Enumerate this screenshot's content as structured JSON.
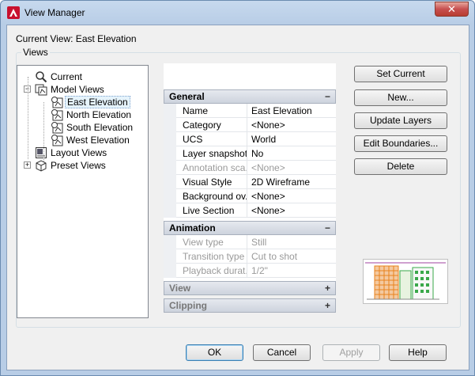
{
  "window": {
    "title": "View Manager",
    "close_label": "✕"
  },
  "current_view": "Current View: East Elevation",
  "views_group_label": "Views",
  "tree": [
    {
      "label": "Current",
      "icon": "magnifier-icon",
      "level": 1,
      "expander": "",
      "selected": false
    },
    {
      "label": "Model Views",
      "icon": "model-views-icon",
      "level": 1,
      "expander": "−",
      "selected": false
    },
    {
      "label": "East Elevation",
      "icon": "named-view-icon",
      "level": 2,
      "expander": "",
      "selected": true
    },
    {
      "label": "North Elevation",
      "icon": "named-view-icon",
      "level": 2,
      "expander": "",
      "selected": false
    },
    {
      "label": "South Elevation",
      "icon": "named-view-icon",
      "level": 2,
      "expander": "",
      "selected": false
    },
    {
      "label": "West Elevation",
      "icon": "named-view-icon",
      "level": 2,
      "expander": "",
      "selected": false
    },
    {
      "label": "Layout Views",
      "icon": "layout-views-icon",
      "level": 1,
      "expander": "",
      "selected": false
    },
    {
      "label": "Preset Views",
      "icon": "preset-views-icon",
      "level": 1,
      "expander": "+",
      "selected": false
    }
  ],
  "properties": {
    "general": {
      "title": "General",
      "toggle": "−",
      "rows": [
        {
          "name": "Name",
          "value": "East Elevation",
          "dim": false
        },
        {
          "name": "Category",
          "value": "<None>",
          "dim": false
        },
        {
          "name": "UCS",
          "value": "World",
          "dim": false
        },
        {
          "name": "Layer snapshot",
          "value": "No",
          "dim": false
        },
        {
          "name": "Annotation sca...",
          "value": "<None>",
          "dim": true
        },
        {
          "name": "Visual Style",
          "value": "2D Wireframe",
          "dim": false
        },
        {
          "name": "Background ov...",
          "value": "<None>",
          "dim": false
        },
        {
          "name": "Live Section",
          "value": "<None>",
          "dim": false
        }
      ]
    },
    "animation": {
      "title": "Animation",
      "toggle": "−",
      "rows": [
        {
          "name": "View type",
          "value": "Still",
          "dim": true
        },
        {
          "name": "Transition type",
          "value": "Cut to shot",
          "dim": true
        },
        {
          "name": "Playback durat...",
          "value": "1/2\"",
          "dim": true
        }
      ]
    },
    "view": {
      "title": "View",
      "toggle": "+"
    },
    "clipping": {
      "title": "Clipping",
      "toggle": "+"
    }
  },
  "side_buttons": [
    {
      "name": "set-current-button",
      "label": "Set Current"
    },
    {
      "name": "new-button",
      "label": "New..."
    },
    {
      "name": "update-layers-button",
      "label": "Update Layers"
    },
    {
      "name": "edit-boundaries-button",
      "label": "Edit Boundaries..."
    },
    {
      "name": "delete-button",
      "label": "Delete"
    }
  ],
  "bottom_buttons": [
    {
      "name": "ok-button",
      "label": "OK",
      "disabled": false,
      "default": true
    },
    {
      "name": "cancel-button",
      "label": "Cancel",
      "disabled": false,
      "default": false
    },
    {
      "name": "apply-button",
      "label": "Apply",
      "disabled": true,
      "default": false
    },
    {
      "name": "help-button",
      "label": "Help",
      "disabled": false,
      "default": false
    }
  ],
  "colors": {
    "accent": "#3c7fb1",
    "selection": "#e5f3fb",
    "preview_orange": "#e8821e",
    "preview_green": "#3aa84a"
  }
}
